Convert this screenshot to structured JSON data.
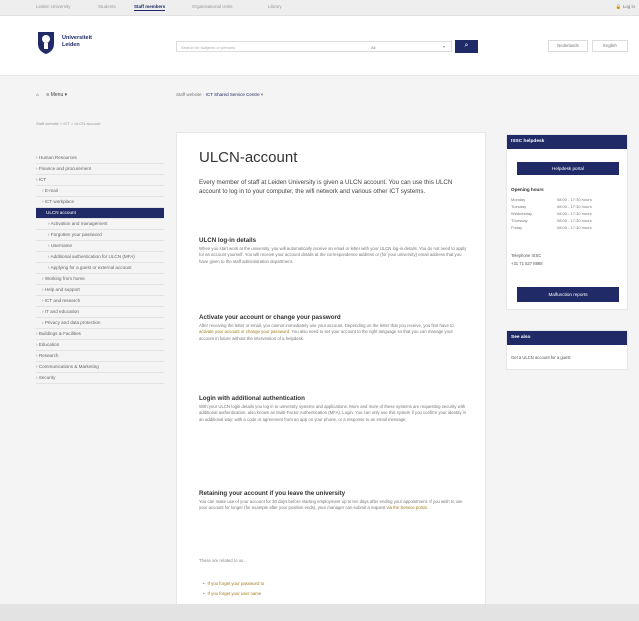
{
  "topbar": {
    "links": [
      "Leiden University",
      "Students",
      "Staff members",
      "Organisational Units",
      "Library"
    ],
    "active_index": 2,
    "login": "Log in"
  },
  "header": {
    "logo_text": [
      "Universiteit",
      "Leiden"
    ],
    "search_placeholder": "Search for subjects or persons",
    "search_scope": "All",
    "search_icon": "search-icon",
    "lang_nl": "Nederlands",
    "lang_en": "English"
  },
  "nav": {
    "menu_label": "Menu",
    "staff_portal": "Staff website",
    "unit": "ICT Shared Service Centre",
    "breadcrumb": "Staff website > ICT > ULCN account"
  },
  "sidebar": {
    "items": [
      {
        "label": "Human Resources",
        "active": false,
        "indent": 0
      },
      {
        "label": "Finance and procurement",
        "active": false,
        "indent": 0
      },
      {
        "label": "ICT",
        "active": false,
        "indent": 0
      },
      {
        "label": "E-mail",
        "active": false,
        "indent": 1
      },
      {
        "label": "ICT workplace",
        "active": false,
        "indent": 1
      },
      {
        "label": "ULCN account",
        "active": true,
        "indent": 1
      },
      {
        "label": "Activation and management",
        "active": false,
        "indent": 2
      },
      {
        "label": "Forgotten your password",
        "active": false,
        "indent": 2
      },
      {
        "label": "Username",
        "active": false,
        "indent": 2
      },
      {
        "label": "Additional authentication for ULCN (MFA)",
        "active": false,
        "indent": 2
      },
      {
        "label": "Applying for a guest or external account",
        "active": false,
        "indent": 2
      },
      {
        "label": "Working from home",
        "active": false,
        "indent": 1
      },
      {
        "label": "Help and support",
        "active": false,
        "indent": 1
      },
      {
        "label": "ICT and research",
        "active": false,
        "indent": 1
      },
      {
        "label": "IT and education",
        "active": false,
        "indent": 1
      },
      {
        "label": "Privacy and data protection",
        "active": false,
        "indent": 1
      },
      {
        "label": "Buildings & Facilities",
        "active": false,
        "indent": 0
      },
      {
        "label": "Education",
        "active": false,
        "indent": 0
      },
      {
        "label": "Research",
        "active": false,
        "indent": 0
      },
      {
        "label": "Communications & Marketing",
        "active": false,
        "indent": 0
      },
      {
        "label": "Security",
        "active": false,
        "indent": 0
      }
    ]
  },
  "article": {
    "title": "ULCN-account",
    "lead": "Every member of staff at Leiden University is given a ULCN account. You can use this ULCN account to log in to your computer, the wifi network and various other ICT systems.",
    "sections": [
      {
        "heading": "ULCN log-in details",
        "body": "When you start work at the university, you will automatically receive an email or letter with your ULCN log-in details. You do not need to apply for an account yourself. You will receive your account details at the correspondence address or (for your university) email address that you have given to the staff administration department."
      },
      {
        "heading": "Activate your account or change your password",
        "body": "After receiving the letter or email, you cannot immediately use your account. Depending on the letter that you receive, you first have to",
        "link": "activate your account or change your password",
        "body2": ". You also need to set your account to the right language so that you can manage your account in future without the intervention of a helpdesk."
      },
      {
        "heading": "Login with additional authentication",
        "body": "With your ULCN login details you log in to university systems and applications. More and more of these systems are requesting security with additional authentication, also known as Multi-Factor Authentication (MFA). Login. You can only use this system if you confirm your identity in an additional way: with a code or agreement from an app on your phone, or a response to an email message."
      },
      {
        "heading": "Retaining your account if you leave the university",
        "body": "You can make use of your account for 30 days before starting employment up to ten days after ending your appointment. If you wish to use your account for longer (for example after your position ends), your manager can submit a request",
        "link": "via the Service portal",
        "body2": "."
      }
    ],
    "related_label": "These are related to us...",
    "related_links": [
      "If you forget your password to",
      "If you forget your user name"
    ]
  },
  "helpdesk": {
    "title": "ISSC helpdesk",
    "button": "Helpdesk portal",
    "hours_title": "Opening hours",
    "hours": [
      {
        "day": "Monday",
        "time": "08:00 - 17:30 hours"
      },
      {
        "day": "Tuesday",
        "time": "08:00 - 17:30 hours"
      },
      {
        "day": "Wednesday",
        "time": "08:00 - 17:30 hours"
      },
      {
        "day": "Thursday",
        "time": "08:00 - 17:30 hours"
      },
      {
        "day": "Friday",
        "time": "08:00 - 17:30 hours"
      }
    ],
    "phone_label": "Telephone ISSC",
    "phone": "+31 71 527 8888",
    "button2": "Malfunction reports"
  },
  "see_also": {
    "title": "See also",
    "text": "Get a ULCN account for a guest"
  },
  "colors": {
    "brand": "#1f2a66",
    "link": "#a07a1a",
    "background": "#f4f4f4"
  }
}
